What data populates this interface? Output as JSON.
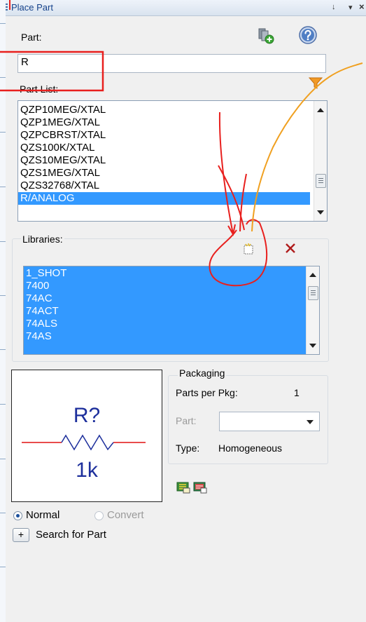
{
  "panel": {
    "title": "Place Part",
    "pin_glyph": "↓",
    "menu_glyph": "▾",
    "close_glyph": "×"
  },
  "part": {
    "label": "Part:",
    "value": "R",
    "add_icon": "add-library-icon",
    "help_icon": "help-icon",
    "filter_icon": "filter-icon"
  },
  "part_list": {
    "label": "Part List:",
    "items": [
      "QZP10MEG/XTAL",
      "QZP1MEG/XTAL",
      "QZPCBRST/XTAL",
      "QZS100K/XTAL",
      "QZS10MEG/XTAL",
      "QZS1MEG/XTAL",
      "QZS32768/XTAL",
      "R/ANALOG"
    ],
    "selected": "R/ANALOG"
  },
  "libraries": {
    "label": "Libraries:",
    "items": [
      "1_SHOT",
      "7400",
      "74AC",
      "74ACT",
      "74ALS",
      "74AS"
    ],
    "add_icon": "add-library-icon",
    "remove_icon": "remove-library-icon"
  },
  "preview": {
    "refdes": "R?",
    "value": "1k"
  },
  "packaging": {
    "label": "Packaging",
    "parts_per_pkg_label": "Parts per Pkg:",
    "parts_per_pkg_value": "1",
    "part_label": "Part:",
    "type_label": "Type:",
    "type_value": "Homogeneous"
  },
  "view": {
    "normal_label": "Normal",
    "convert_label": "Convert",
    "selected": "Normal"
  },
  "search": {
    "button_glyph": "+",
    "label": "Search for Part"
  },
  "colors": {
    "accent": "#3399ff",
    "title_text": "#15428b",
    "annotation_red": "#e8201e",
    "annotation_orange": "#f0a020"
  }
}
